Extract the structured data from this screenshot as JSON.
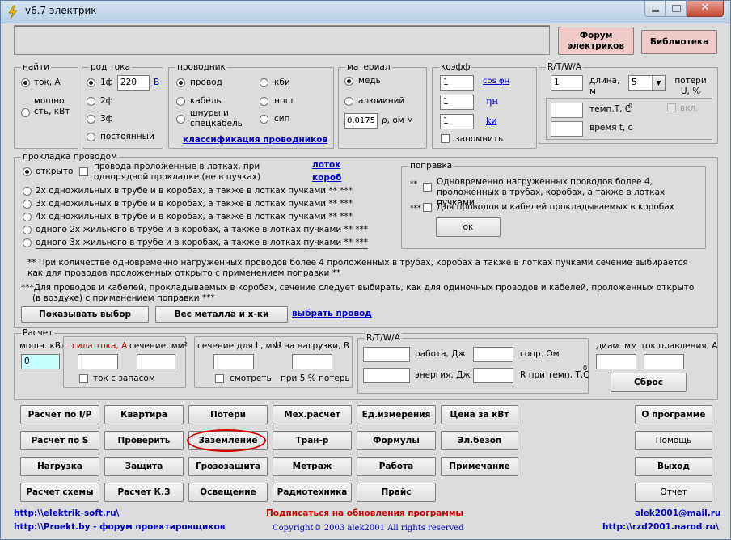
{
  "window": {
    "title": "v6.7 электрик",
    "minimize_icon": "minimize-icon",
    "maximize_icon": "maximize-icon",
    "close_icon": "close-icon",
    "app_icon": "lightning-icon"
  },
  "top": {
    "forum_label": "Форум электриков",
    "library_label": "Библиотека"
  },
  "find": {
    "title": "найти",
    "option1": "ток, А",
    "option2": "мощно сть, кВт"
  },
  "current_type": {
    "title": "род тока",
    "phase1": "1ф",
    "voltage": "220",
    "voltage_unit": "В",
    "phase2": "2ф",
    "phase3": "3ф",
    "dc": "постоянный"
  },
  "conductor": {
    "title": "проводник",
    "wire": "провод",
    "cable": "кабель",
    "cords": "шнуры и спецкабель",
    "kbi": "кби",
    "npsh": "нпш",
    "sip": "сип",
    "classification_link": "классификация проводников"
  },
  "material": {
    "title": "материал",
    "copper": "медь",
    "aluminum": "алюминий",
    "rho_value": "0,0175",
    "rho_label": "ρ, ом м"
  },
  "coeff": {
    "title": "коэфф",
    "cos_value": "1",
    "cos_label": "cos φн",
    "eta_value": "1",
    "eta_label": "ηн",
    "k_value": "1",
    "k_label": "kи",
    "remember": "запомнить"
  },
  "rtwa_top": {
    "title": "R/T/W/A",
    "length_value": "1",
    "length_label": "длина, м",
    "loss_value": "5",
    "loss_label": "потери U, %",
    "temp_label": "темп.Т, С",
    "temp_unit": "0",
    "enable_label": "вкл.",
    "time_label": "время t, с"
  },
  "laying": {
    "title": "прокладка проводом",
    "open": "открыто",
    "trays_check": "провода проложенные в лотках, при однорядной прокладке (не в пучках)",
    "tray_link": "лоток",
    "box_link": "короб",
    "options": [
      "2х одножильных в трубе и в коробах, а также в лотках пучками ** ***",
      "3х одножильных в трубе и в коробах, а также в лотках пучками ** ***",
      "4х одножильных в трубе и в коробах, а также в лотках пучками ** ***",
      "одного 2х жильного в трубе и в коробах, а также в лотках пучками ** ***",
      "одного 3х жильного в трубе и в коробах, а также в лотках пучками ** ***"
    ]
  },
  "correction": {
    "title": "поправка",
    "mark1": "**",
    "text1": "Одновременно нагруженных проводов более 4, проложенных в трубах, коробах, а также в лотках пучками",
    "mark2": "***",
    "text2": "Для проводов и кабелей прокладываемых в коробах",
    "ok": "ок"
  },
  "notes": {
    "note1": "** При количестве одновременно нагруженных проводов более 4 проложенных в трубах, коробах а также в лотках пучками сечение выбирается как для проводов проложенных открыто с применением поправки **",
    "note2a": "***Для проводов и кабелей, прокладываемых в коробах, сечение следует выбирать, как для одиночных проводов и кабелей, проложенных открыто",
    "note2b": "(в воздухе) с применением поправки ***"
  },
  "actions": {
    "show_choice": "Показывать выбор",
    "weight": "Вес металла и х-ки",
    "choose_wire": "выбрать провод"
  },
  "calc": {
    "title": "Расчет",
    "power_label": "мошн. кВт",
    "power_value": "0",
    "current_label": "сила тока, А",
    "section_label": "сечение, мм²",
    "reserve_label": "ток с запасом",
    "sec_lu_label": "сечение для L, мм²",
    "u_load_label": "U на нагрузки, В",
    "watch_label": "смотреть",
    "loss5_label": "при 5 % потерь",
    "rtwa_title": "R/T/W/A",
    "work_label": "работа, Дж",
    "resist_label": "сопр. Ом",
    "energy_label": "энергия, Дж",
    "r_temp_label": "R при темп. Т,С",
    "r_temp_unit": "0",
    "diam_label": "диам. мм",
    "melt_label": "ток плавления, А",
    "reset": "Сброс"
  },
  "buttons": {
    "calc_ip": "Расчет по I/P",
    "apartment": "Квартира",
    "losses": "Потери",
    "mech": "Мех.расчет",
    "units": "Ед.измерения",
    "price_kwt": "Цена за кВт",
    "about": "О программе",
    "calc_s": "Расчет по S",
    "check": "Проверить",
    "grounding": "Заземление",
    "transformer": "Тран-р",
    "formulas": "Формулы",
    "elsafety": "Эл.безоп",
    "help": "Помощь",
    "load": "Нагрузка",
    "protection": "Защита",
    "lightning": "Грозозащита",
    "footage": "Метраж",
    "work": "Работа",
    "note": "Примечание",
    "exit": "Выход",
    "scheme": "Расчет схемы",
    "short_circuit": "Расчет К.З",
    "lighting": "Освещение",
    "radio": "Радиотехника",
    "price": "Прайс",
    "report": "Отчет"
  },
  "footer": {
    "url1": "http:\\\\elektrik-soft.ru\\",
    "url2": "http:\\\\Proekt.by - форум проектировщиков",
    "subscribe": "Подписаться на обновления программы",
    "copyright": "Copyright© 2003 alek2001 All rights reserved",
    "email": "alek2001@mail.ru",
    "url3": "http:\\\\rzd2001.narod.ru\\"
  },
  "colors": {
    "accent_pink": "#f2c9c9",
    "red_text": "#cc0000",
    "link_blue": "#0000cc",
    "highlight_circle": "#d40000",
    "cyan_field": "#c8ffff"
  }
}
